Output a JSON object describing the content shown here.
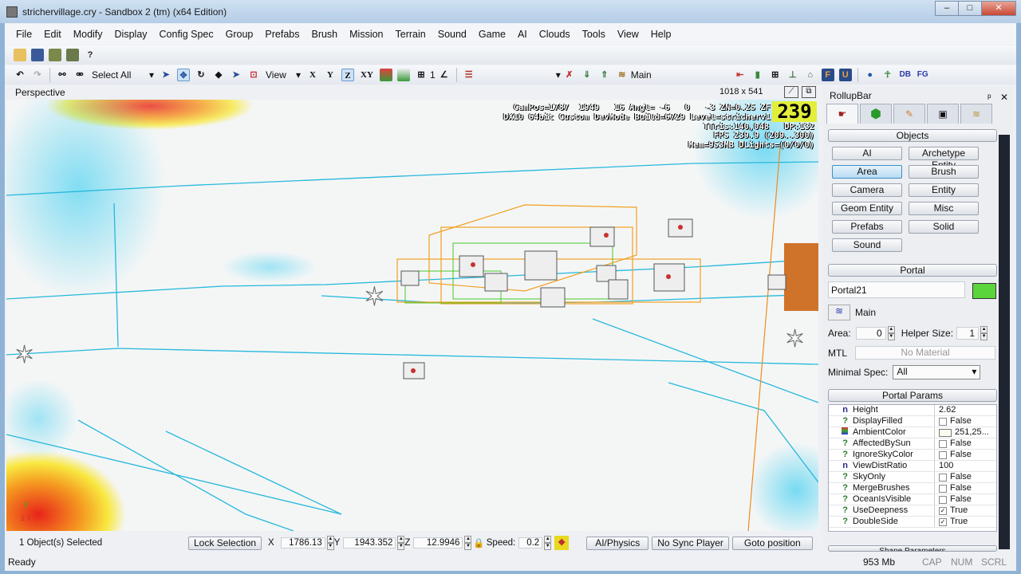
{
  "window": {
    "title": "strichervillage.cry - Sandbox 2 (tm) (x64 Edition)",
    "min": "–",
    "max": "□",
    "close": "✕"
  },
  "menu": [
    "File",
    "Edit",
    "Modify",
    "Display",
    "Config Spec",
    "Group",
    "Prefabs",
    "Brush",
    "Mission",
    "Terrain",
    "Sound",
    "Game",
    "AI",
    "Clouds",
    "Tools",
    "View",
    "Help"
  ],
  "toolbar": {
    "select_filter": "Select All",
    "view_combo": "View",
    "axes": [
      "X",
      "Y",
      "Z",
      "XY"
    ],
    "grid_value": "1",
    "layer": "Main",
    "db": "DB",
    "fg": "FG"
  },
  "viewport": {
    "name": "Perspective",
    "size": "1018 x 541",
    "info_lines": [
      "CamPos=1787  1949   16 Angl= -6   0   -3 ZN=0.25 ZF",
      "DX10 64bit Custom DevMode Build=6729 Level=stricherv1",
      "TTris:140,048   DP:132",
      "FPS 239.9 (209..300)",
      "Mem=953MB DLights=(0/0/0)"
    ],
    "fps_big": "239"
  },
  "rollup": {
    "title": "RollupBar",
    "pin": "ᵖ",
    "close": "✕",
    "objects_header": "Objects",
    "object_buttons": [
      "AI",
      "Archetype Entity",
      "Area",
      "Brush",
      "Camera",
      "Entity",
      "Geom Entity",
      "Misc",
      "Prefabs",
      "Solid",
      "Sound"
    ],
    "selected_button": "Area",
    "portal_header": "Portal",
    "name": "Portal21",
    "color": "#5ad63c",
    "layer": "Main",
    "area_label": "Area:",
    "area_value": "0",
    "helper_label": "Helper Size:",
    "helper_value": "1",
    "mtl_label": "MTL",
    "mtl_value": "No Material",
    "spec_label": "Minimal Spec:",
    "spec_value": "All",
    "params_header": "Portal Params",
    "params": [
      {
        "icon": "n",
        "name": "Height",
        "value": "2.62"
      },
      {
        "icon": "?",
        "name": "DisplayFilled",
        "value": "False",
        "check": false
      },
      {
        "icon": "color",
        "name": "AmbientColor",
        "value": "251,25..."
      },
      {
        "icon": "?",
        "name": "AffectedBySun",
        "value": "False",
        "check": false
      },
      {
        "icon": "?",
        "name": "IgnoreSkyColor",
        "value": "False",
        "check": false
      },
      {
        "icon": "n",
        "name": "ViewDistRatio",
        "value": "100"
      },
      {
        "icon": "?",
        "name": "SkyOnly",
        "value": "False",
        "check": false
      },
      {
        "icon": "?",
        "name": "MergeBrushes",
        "value": "False",
        "check": false
      },
      {
        "icon": "?",
        "name": "OceanIsVisible",
        "value": "False",
        "check": false
      },
      {
        "icon": "?",
        "name": "UseDeepness",
        "value": "True",
        "check": true
      },
      {
        "icon": "?",
        "name": "DoubleSide",
        "value": "True",
        "check": true
      }
    ],
    "shape_header": "Shape Parameters"
  },
  "bottom": {
    "selected": "1 Object(s) Selected",
    "lock": "Lock Selection",
    "x_label": "X",
    "x": "1786.13",
    "y_label": "Y",
    "y": "1943.352",
    "z_label": "Z",
    "z": "12.9946",
    "speed_label": "Speed:",
    "speed": "0.2",
    "ai_physics": "AI/Physics",
    "no_sync": "No Sync Player",
    "goto": "Goto position"
  },
  "status": {
    "text": "Ready",
    "mem": "953 Mb",
    "cap": "CAP",
    "num": "NUM",
    "scrl": "SCRL"
  }
}
